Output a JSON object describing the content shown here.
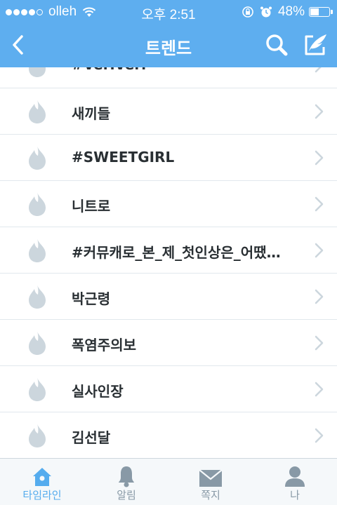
{
  "status_bar": {
    "carrier": "olleh",
    "time": "오후 2:51",
    "battery_percent": "48%",
    "battery_level": 0.48
  },
  "nav": {
    "title": "트렌드",
    "back_icon": "chevron-left-icon",
    "search_icon": "search-icon",
    "compose_icon": "compose-icon"
  },
  "trends": [
    {
      "label": "#VeriVeri"
    },
    {
      "label": "새끼들"
    },
    {
      "label": "#SWEETGIRL"
    },
    {
      "label": "니트로"
    },
    {
      "label": "#커뮤캐로_본_제_첫인상은_어땠..."
    },
    {
      "label": "박근령"
    },
    {
      "label": "폭염주의보"
    },
    {
      "label": "실사인장"
    },
    {
      "label": "김선달"
    }
  ],
  "tabs": [
    {
      "label": "타임라인",
      "icon": "home-icon",
      "active": true
    },
    {
      "label": "알림",
      "icon": "bell-icon",
      "active": false
    },
    {
      "label": "쪽지",
      "icon": "envelope-icon",
      "active": false
    },
    {
      "label": "나",
      "icon": "person-icon",
      "active": false
    }
  ],
  "colors": {
    "accent": "#5eaeef",
    "flame": "#ccd6dd",
    "chevron": "#ccd6dd",
    "tab_active": "#55acee",
    "tab_inactive": "#8899a6"
  }
}
